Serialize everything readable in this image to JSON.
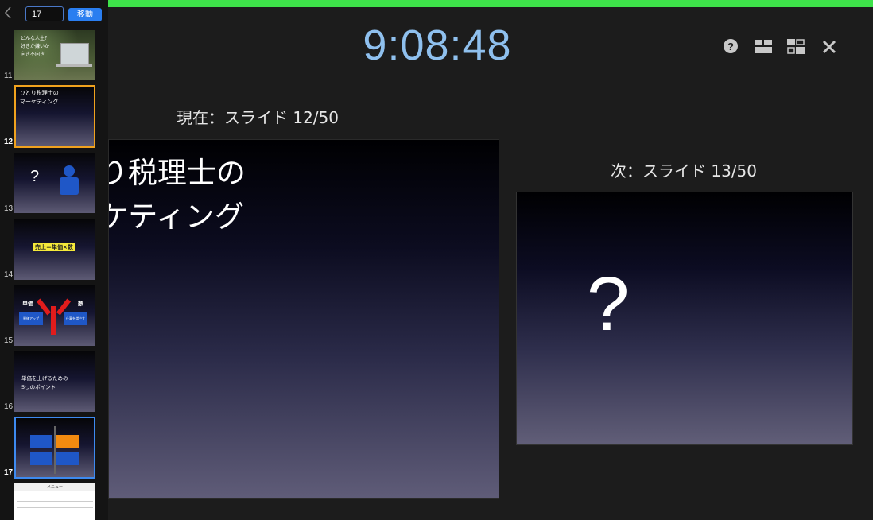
{
  "sidebar": {
    "jump_value": "17",
    "go_label": "移動",
    "thumbs": [
      {
        "num": "11",
        "text": "どんな人生？\n好きか嫌いか\n向き不向き"
      },
      {
        "num": "12",
        "text": "ひとり税理士の\nマーケティング"
      },
      {
        "num": "13",
        "text": "?"
      },
      {
        "num": "14",
        "text": "売上＝単価×数"
      },
      {
        "num": "15",
        "labels": [
          "単価",
          "数",
          "単価アップ",
          "仕事を増やす"
        ]
      },
      {
        "num": "16",
        "text": "単価を上げるための\n5つのポイント"
      },
      {
        "num": "17"
      },
      {
        "num": "",
        "text": "メニュー"
      }
    ]
  },
  "clock": "9:08:48",
  "current": {
    "label": "現在：スライド 12/50",
    "text": "ひとり税理士の\nマーケティング"
  },
  "next": {
    "label": "次：スライド 13/50",
    "text": "?"
  },
  "icons": [
    "help-icon",
    "layout-icon",
    "swap-displays-icon",
    "close-icon"
  ]
}
